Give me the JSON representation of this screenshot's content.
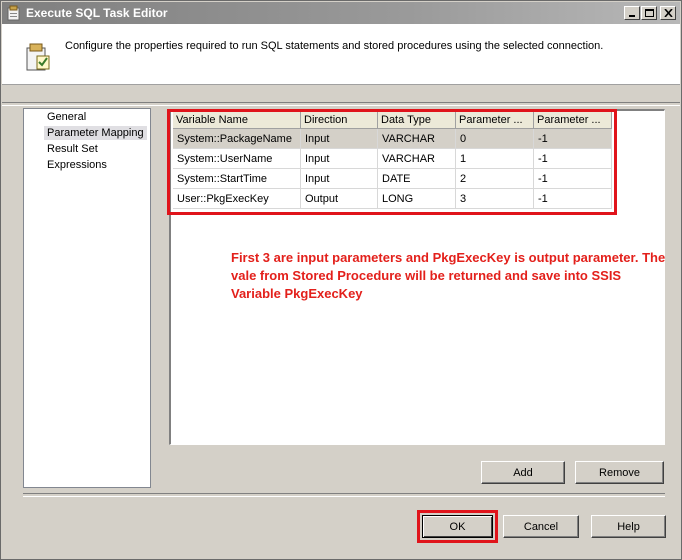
{
  "window": {
    "title": "Execute SQL Task Editor",
    "description": "Configure the properties required to run SQL statements and stored procedures using the selected connection."
  },
  "nav": {
    "items": [
      {
        "label": "General",
        "selected": false
      },
      {
        "label": "Parameter Mapping",
        "selected": true
      },
      {
        "label": "Result Set",
        "selected": false
      },
      {
        "label": "Expressions",
        "selected": false
      }
    ]
  },
  "grid": {
    "columns": [
      "Variable Name",
      "Direction",
      "Data Type",
      "Parameter ...",
      "Parameter ..."
    ],
    "rows": [
      [
        "System::PackageName",
        "Input",
        "VARCHAR",
        "0",
        "-1"
      ],
      [
        "System::UserName",
        "Input",
        "VARCHAR",
        "1",
        "-1"
      ],
      [
        "System::StartTime",
        "Input",
        "DATE",
        "2",
        "-1"
      ],
      [
        "User::PkgExecKey",
        "Output",
        "LONG",
        "3",
        "-1"
      ]
    ]
  },
  "annotation": {
    "text": "First 3 are input parameters and PkgExecKey is output parameter. The vale from Stored Procedure will be returned and save into SSIS Variable PkgExecKey",
    "color": "#e3201b"
  },
  "buttons": {
    "add": "Add",
    "remove": "Remove",
    "ok": "OK",
    "cancel": "Cancel",
    "help": "Help"
  },
  "colors": {
    "highlight": "#e0141b",
    "dialog_face": "#d4d0c8"
  },
  "icons": {
    "title": "sql-task-icon",
    "header": "properties-page-icon",
    "minimize": "minimize-icon",
    "maximize": "maximize-icon",
    "close": "close-icon"
  }
}
